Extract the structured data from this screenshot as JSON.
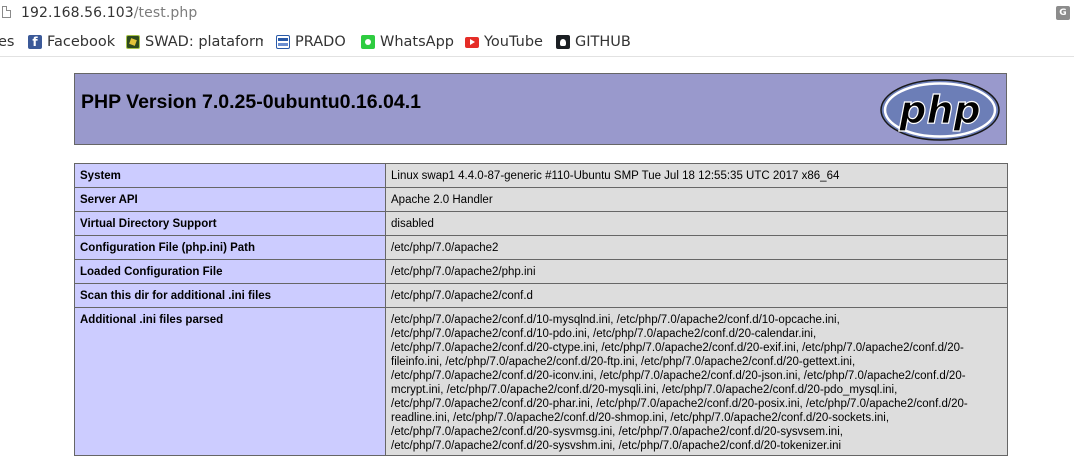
{
  "address_bar": {
    "host": "192.168.56.103",
    "path": "/test.php"
  },
  "bookmarks": [
    {
      "label": "es",
      "icon": "none"
    },
    {
      "label": "Facebook",
      "icon": "facebook-icon"
    },
    {
      "label": "SWAD: plataform",
      "icon": "swad-icon"
    },
    {
      "label": "PRADO",
      "icon": "prado-icon"
    },
    {
      "label": "WhatsApp",
      "icon": "whatsapp-icon"
    },
    {
      "label": "YouTube",
      "icon": "youtube-icon"
    },
    {
      "label": "GITHUB",
      "icon": "github-icon"
    }
  ],
  "phpinfo": {
    "title": "PHP Version 7.0.25-0ubuntu0.16.04.1",
    "logo_text": "php",
    "rows": [
      {
        "key": "System",
        "value": "Linux swap1 4.4.0-87-generic #110-Ubuntu SMP Tue Jul 18 12:55:35 UTC 2017 x86_64"
      },
      {
        "key": "Server API",
        "value": "Apache 2.0 Handler"
      },
      {
        "key": "Virtual Directory Support",
        "value": "disabled"
      },
      {
        "key": "Configuration File (php.ini) Path",
        "value": "/etc/php/7.0/apache2"
      },
      {
        "key": "Loaded Configuration File",
        "value": "/etc/php/7.0/apache2/php.ini"
      },
      {
        "key": "Scan this dir for additional .ini files",
        "value": "/etc/php/7.0/apache2/conf.d"
      },
      {
        "key": "Additional .ini files parsed",
        "value_lines": [
          "/etc/php/7.0/apache2/conf.d/10-mysqlnd.ini, /etc/php/7.0/apache2/conf.d/10-opcache.ini,",
          "/etc/php/7.0/apache2/conf.d/10-pdo.ini, /etc/php/7.0/apache2/conf.d/20-calendar.ini,",
          "/etc/php/7.0/apache2/conf.d/20-ctype.ini, /etc/php/7.0/apache2/conf.d/20-exif.ini, /etc/php/7.0/apache2/conf.d/20-",
          "fileinfo.ini, /etc/php/7.0/apache2/conf.d/20-ftp.ini, /etc/php/7.0/apache2/conf.d/20-gettext.ini,",
          "/etc/php/7.0/apache2/conf.d/20-iconv.ini, /etc/php/7.0/apache2/conf.d/20-json.ini, /etc/php/7.0/apache2/conf.d/20-",
          "mcrypt.ini, /etc/php/7.0/apache2/conf.d/20-mysqli.ini, /etc/php/7.0/apache2/conf.d/20-pdo_mysql.ini,",
          "/etc/php/7.0/apache2/conf.d/20-phar.ini, /etc/php/7.0/apache2/conf.d/20-posix.ini, /etc/php/7.0/apache2/conf.d/20-",
          "readline.ini, /etc/php/7.0/apache2/conf.d/20-shmop.ini, /etc/php/7.0/apache2/conf.d/20-sockets.ini,",
          "/etc/php/7.0/apache2/conf.d/20-sysvmsg.ini, /etc/php/7.0/apache2/conf.d/20-sysvsem.ini,",
          "/etc/php/7.0/apache2/conf.d/20-sysvshm.ini, /etc/php/7.0/apache2/conf.d/20-tokenizer.ini"
        ]
      }
    ]
  },
  "colors": {
    "header_bg": "#9999cc",
    "key_bg": "#ccccff",
    "value_bg": "#dddddd"
  }
}
